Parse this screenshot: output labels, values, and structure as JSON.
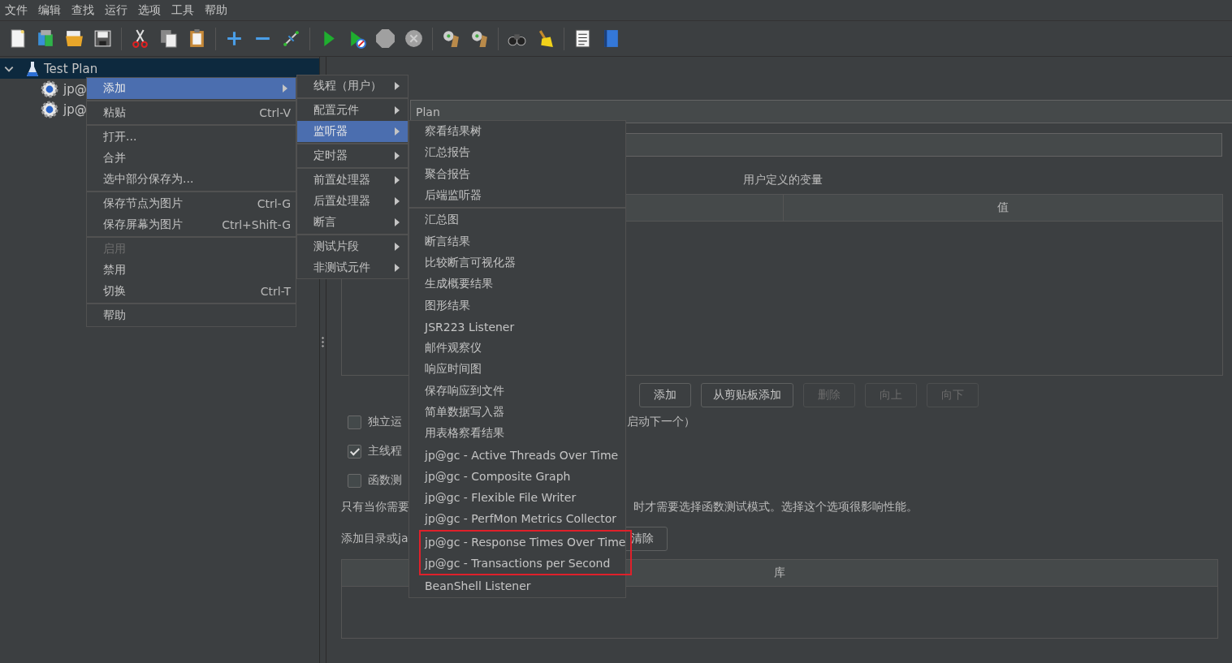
{
  "menu_bar": [
    "文件",
    "编辑",
    "查找",
    "运行",
    "选项",
    "工具",
    "帮助"
  ],
  "tree": [
    {
      "label": "Test Plan",
      "selected": true,
      "expanded": true,
      "children": [
        {
          "label": "jp@",
          "selected": false
        },
        {
          "label": "jp@",
          "selected": false
        }
      ]
    }
  ],
  "context_menu": {
    "groups": [
      [
        {
          "label": "添加",
          "submenu": true,
          "selected": true,
          "disabled": false
        }
      ],
      [
        {
          "label": "粘贴",
          "shortcut": "Ctrl-V",
          "submenu": false,
          "selected": false,
          "disabled": false
        }
      ],
      [
        {
          "label": "打开...",
          "submenu": false,
          "selected": false,
          "disabled": false
        },
        {
          "label": "合并",
          "submenu": false,
          "selected": false,
          "disabled": false
        },
        {
          "label": "选中部分保存为...",
          "submenu": false,
          "selected": false,
          "disabled": false
        }
      ],
      [
        {
          "label": "保存节点为图片",
          "shortcut": "Ctrl-G",
          "submenu": false,
          "selected": false,
          "disabled": false
        },
        {
          "label": "保存屏幕为图片",
          "shortcut": "Ctrl+Shift-G",
          "submenu": false,
          "selected": false,
          "disabled": false
        }
      ],
      [
        {
          "label": "启用",
          "submenu": false,
          "selected": false,
          "disabled": true
        },
        {
          "label": "禁用",
          "submenu": false,
          "selected": false,
          "disabled": false
        },
        {
          "label": "切换",
          "shortcut": "Ctrl-T",
          "submenu": false,
          "selected": false,
          "disabled": false
        }
      ],
      [
        {
          "label": "帮助",
          "submenu": false,
          "selected": false,
          "disabled": false
        }
      ]
    ]
  },
  "add_submenu": {
    "groups": [
      [
        {
          "label": "线程（用户）",
          "submenu": true,
          "selected": false
        }
      ],
      [
        {
          "label": "配置元件",
          "submenu": true,
          "selected": false
        },
        {
          "label": "监听器",
          "submenu": true,
          "selected": true
        }
      ],
      [
        {
          "label": "定时器",
          "submenu": true,
          "selected": false
        }
      ],
      [
        {
          "label": "前置处理器",
          "submenu": true,
          "selected": false
        },
        {
          "label": "后置处理器",
          "submenu": true,
          "selected": false
        },
        {
          "label": "断言",
          "submenu": true,
          "selected": false
        }
      ],
      [
        {
          "label": "测试片段",
          "submenu": true,
          "selected": false
        },
        {
          "label": "非测试元件",
          "submenu": true,
          "selected": false
        }
      ]
    ]
  },
  "listener_submenu": {
    "groups": [
      [
        {
          "label": "察看结果树",
          "highlighted": false
        },
        {
          "label": "汇总报告",
          "highlighted": false
        },
        {
          "label": "聚合报告",
          "highlighted": false
        },
        {
          "label": "后端监听器",
          "highlighted": false
        }
      ],
      [
        {
          "label": "汇总图",
          "highlighted": false
        },
        {
          "label": "断言结果",
          "highlighted": false
        },
        {
          "label": "比较断言可视化器",
          "highlighted": false
        },
        {
          "label": "生成概要结果",
          "highlighted": false
        },
        {
          "label": "图形结果",
          "highlighted": false
        },
        {
          "label": "JSR223 Listener",
          "highlighted": false
        },
        {
          "label": "邮件观察仪",
          "highlighted": false
        },
        {
          "label": "响应时间图",
          "highlighted": false
        },
        {
          "label": "保存响应到文件",
          "highlighted": false
        },
        {
          "label": "简单数据写入器",
          "highlighted": false
        },
        {
          "label": "用表格察看结果",
          "highlighted": false
        },
        {
          "label": "jp@gc - Active Threads Over Time",
          "highlighted": false
        },
        {
          "label": "jp@gc - Composite Graph",
          "highlighted": false
        },
        {
          "label": "jp@gc - Flexible File Writer",
          "highlighted": false
        },
        {
          "label": "jp@gc - PerfMon Metrics Collector",
          "highlighted": false
        },
        {
          "label": "jp@gc - Response Times Over Time",
          "highlighted": true
        },
        {
          "label": "jp@gc - Transactions per Second",
          "highlighted": true
        },
        {
          "label": "BeanShell Listener",
          "highlighted": false
        }
      ]
    ]
  },
  "name_field": {
    "value": "Plan"
  },
  "variables": {
    "title": "用户定义的变量",
    "columns": [
      "值"
    ]
  },
  "buttons": [
    {
      "label": "添加",
      "disabled": false
    },
    {
      "label": "从剪贴板添加",
      "disabled": false
    },
    {
      "label": "删除",
      "disabled": true
    },
    {
      "label": "向上",
      "disabled": true
    },
    {
      "label": "向下",
      "disabled": true
    }
  ],
  "options": [
    {
      "label": "独立运",
      "tail": "启动下一个）",
      "checked": false
    },
    {
      "label": "主线程",
      "checked": true
    },
    {
      "label": "函数测",
      "checked": false
    }
  ],
  "functional_note": {
    "start": "只有当你需要",
    "end": "时才需要选择函数测试模式。选择这个选项很影响性能。"
  },
  "classpath": {
    "label": "添加目录或ja",
    "clear_button": "清除",
    "columns": [
      "库"
    ]
  }
}
